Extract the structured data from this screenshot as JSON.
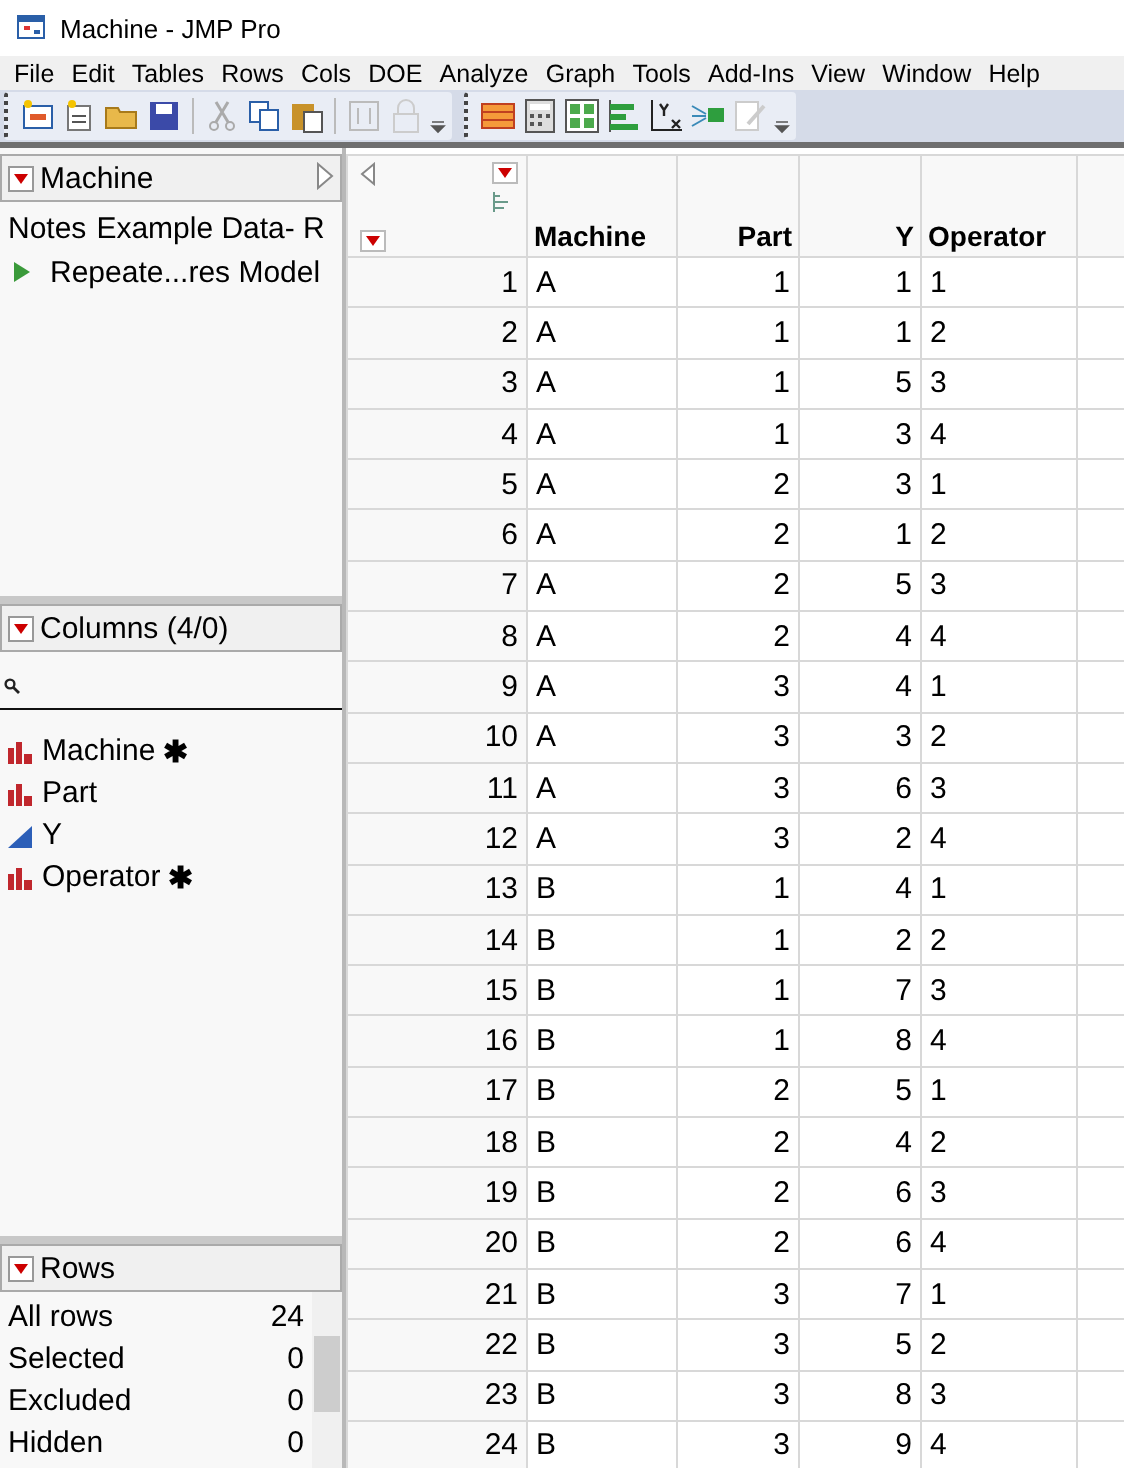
{
  "window": {
    "title": "Machine - JMP Pro"
  },
  "menu": [
    "File",
    "Edit",
    "Tables",
    "Rows",
    "Cols",
    "DOE",
    "Analyze",
    "Graph",
    "Tools",
    "Add-Ins",
    "View",
    "Window",
    "Help"
  ],
  "table_panel": {
    "title": "Machine",
    "items": [
      {
        "kind": "note",
        "label": "Notes",
        "value": "Example Data- R"
      },
      {
        "kind": "script",
        "label": "Repeate...res Model"
      }
    ]
  },
  "columns_panel": {
    "title": "Columns (4/0)",
    "items": [
      {
        "name": "Machine",
        "kind": "nominal",
        "badge": "✱"
      },
      {
        "name": "Part",
        "kind": "nominal"
      },
      {
        "name": "Y",
        "kind": "continuous"
      },
      {
        "name": "Operator",
        "kind": "nominal",
        "badge": "✱"
      }
    ]
  },
  "rows_panel": {
    "title": "Rows",
    "items": [
      {
        "label": "All rows",
        "value": "24"
      },
      {
        "label": "Selected",
        "value": "0"
      },
      {
        "label": "Excluded",
        "value": "0"
      },
      {
        "label": "Hidden",
        "value": "0"
      }
    ]
  },
  "table": {
    "columns": [
      {
        "name": "Machine",
        "kind": "character"
      },
      {
        "name": "Part",
        "kind": "numeric"
      },
      {
        "name": "Y",
        "kind": "numeric"
      },
      {
        "name": "Operator",
        "kind": "character"
      }
    ],
    "rows": [
      {
        "number": "1",
        "cells": [
          "A",
          "1",
          "1",
          "1"
        ]
      },
      {
        "number": "2",
        "cells": [
          "A",
          "1",
          "1",
          "2"
        ]
      },
      {
        "number": "3",
        "cells": [
          "A",
          "1",
          "5",
          "3"
        ]
      },
      {
        "number": "4",
        "cells": [
          "A",
          "1",
          "3",
          "4"
        ]
      },
      {
        "number": "5",
        "cells": [
          "A",
          "2",
          "3",
          "1"
        ]
      },
      {
        "number": "6",
        "cells": [
          "A",
          "2",
          "1",
          "2"
        ]
      },
      {
        "number": "7",
        "cells": [
          "A",
          "2",
          "5",
          "3"
        ]
      },
      {
        "number": "8",
        "cells": [
          "A",
          "2",
          "4",
          "4"
        ]
      },
      {
        "number": "9",
        "cells": [
          "A",
          "3",
          "4",
          "1"
        ]
      },
      {
        "number": "10",
        "cells": [
          "A",
          "3",
          "3",
          "2"
        ]
      },
      {
        "number": "11",
        "cells": [
          "A",
          "3",
          "6",
          "3"
        ]
      },
      {
        "number": "12",
        "cells": [
          "A",
          "3",
          "2",
          "4"
        ]
      },
      {
        "number": "13",
        "cells": [
          "B",
          "1",
          "4",
          "1"
        ]
      },
      {
        "number": "14",
        "cells": [
          "B",
          "1",
          "2",
          "2"
        ]
      },
      {
        "number": "15",
        "cells": [
          "B",
          "1",
          "7",
          "3"
        ]
      },
      {
        "number": "16",
        "cells": [
          "B",
          "1",
          "8",
          "4"
        ]
      },
      {
        "number": "17",
        "cells": [
          "B",
          "2",
          "5",
          "1"
        ]
      },
      {
        "number": "18",
        "cells": [
          "B",
          "2",
          "4",
          "2"
        ]
      },
      {
        "number": "19",
        "cells": [
          "B",
          "2",
          "6",
          "3"
        ]
      },
      {
        "number": "20",
        "cells": [
          "B",
          "2",
          "6",
          "4"
        ]
      },
      {
        "number": "21",
        "cells": [
          "B",
          "3",
          "7",
          "1"
        ]
      },
      {
        "number": "22",
        "cells": [
          "B",
          "3",
          "5",
          "2"
        ]
      },
      {
        "number": "23",
        "cells": [
          "B",
          "3",
          "8",
          "3"
        ]
      },
      {
        "number": "24",
        "cells": [
          "B",
          "3",
          "9",
          "4"
        ]
      }
    ]
  }
}
